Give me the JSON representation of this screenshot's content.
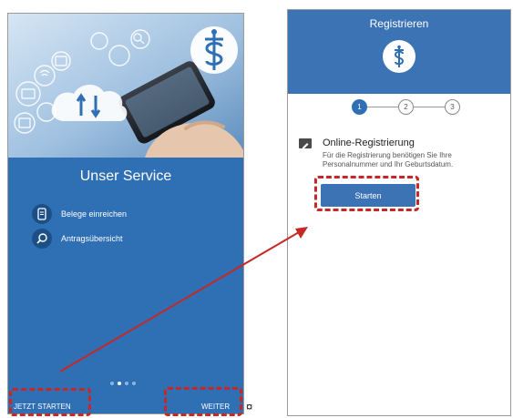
{
  "left_screen": {
    "section_title": "Unser Service",
    "service_items": [
      {
        "label": "Belege einreichen",
        "icon": "phone-document-icon"
      },
      {
        "label": "Antragsübersicht",
        "icon": "magnifier-icon"
      }
    ],
    "pager": {
      "page_count": 4,
      "active_index": 1
    },
    "start_now_label": "JETZT STARTEN",
    "next_label": "WEITER"
  },
  "right_screen": {
    "header_title": "Registrieren",
    "steps": [
      "1",
      "2",
      "3"
    ],
    "active_step": 1,
    "section_title": "Online-Registrierung",
    "section_description": "Für die Registrierung benötigen Sie Ihre Personalnummer und Ihr Geburtsdatum.",
    "start_button_label": "Starten"
  },
  "stray_glyph": "¤",
  "colors": {
    "primary_blue": "#2f6fb3",
    "header_blue": "#3c73b5",
    "annotation_red": "#c62828"
  }
}
